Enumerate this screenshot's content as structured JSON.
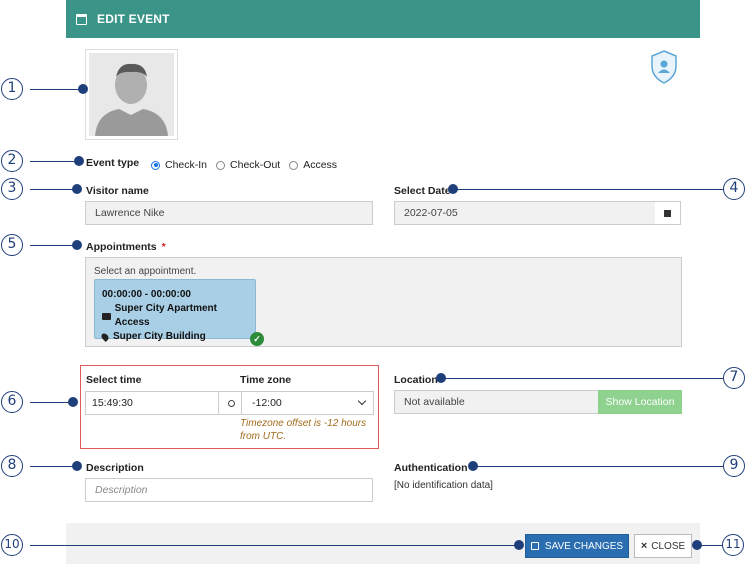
{
  "header": {
    "title": "EDIT EVENT"
  },
  "event_type": {
    "label": "Event type",
    "options": [
      "Check-In",
      "Check-Out",
      "Access"
    ],
    "selected": "Check-In"
  },
  "visitor": {
    "label": "Visitor name",
    "value": "Lawrence Nike"
  },
  "date": {
    "label": "Select Date",
    "value": "2022-07-05"
  },
  "appointments": {
    "label": "Appointments",
    "required_mark": "*",
    "hint": "Select an appointment.",
    "card": {
      "time": "00:00:00 - 00:00:00",
      "access": "Super City Apartment Access",
      "building": "Super City Building"
    }
  },
  "time": {
    "label": "Select time",
    "value": "15:49:30",
    "tz_label": "Time zone",
    "tz_value": "-12:00",
    "tz_note": "Timezone offset is -12 hours from UTC."
  },
  "location": {
    "label": "Location",
    "value": "Not available",
    "button": "Show Location"
  },
  "description": {
    "label": "Description",
    "placeholder": "Description"
  },
  "authentication": {
    "label": "Authentication",
    "value": "[No identification data]"
  },
  "footer": {
    "save_label": "SAVE CHANGES",
    "close_label": "CLOSE"
  },
  "annotations": [
    "1",
    "2",
    "3",
    "4",
    "5",
    "6",
    "7",
    "8",
    "9",
    "10",
    "11"
  ],
  "colors": {
    "header": "#3a9488",
    "primary": "#2a6db0",
    "success": "#8fd18f",
    "annotation": "#1f3f7a",
    "error_border": "#e05b5b"
  }
}
